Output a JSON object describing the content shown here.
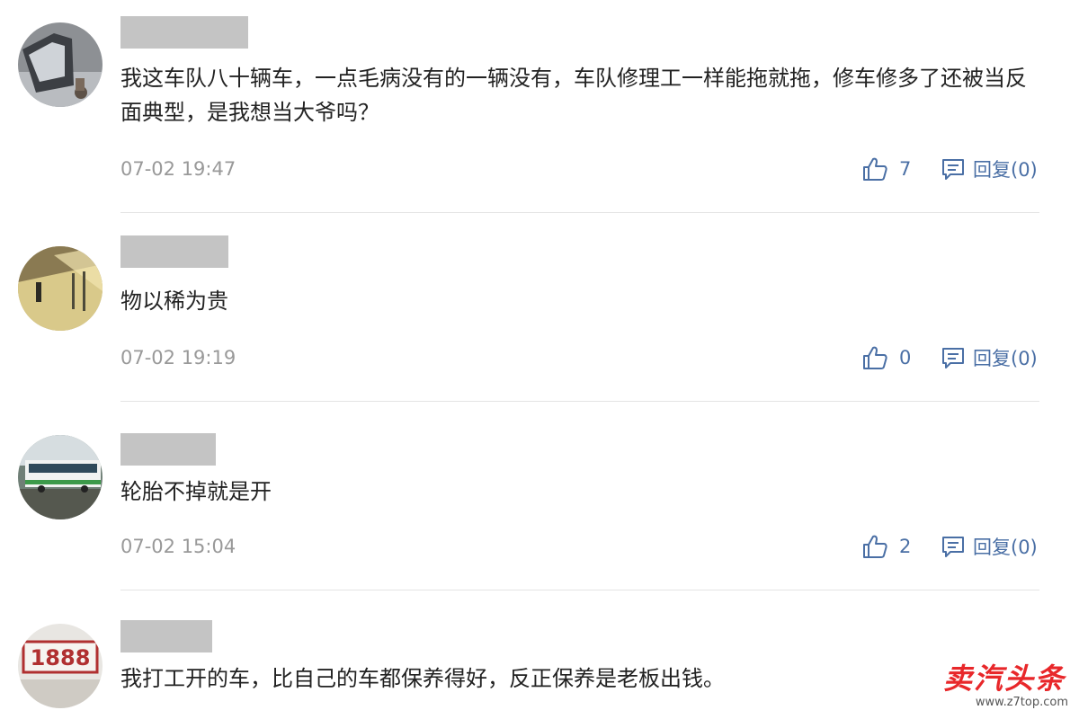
{
  "comments": [
    {
      "avatar": "car-photo-avatar",
      "text": "我这车队八十辆车，一点毛病没有的一辆没有，车队修理工一样能拖就拖，修车修多了还被当反面典型，是我想当大爷吗？",
      "time": "07-02 19:47",
      "likes": "7",
      "reply": "回复(0)"
    },
    {
      "avatar": "sunset-photo-avatar",
      "text": "物以稀为贵",
      "time": "07-02 19:19",
      "likes": "0",
      "reply": "回复(0)"
    },
    {
      "avatar": "bus-photo-avatar",
      "text": "轮胎不掉就是开",
      "time": "07-02 15:04",
      "likes": "2",
      "reply": "回复(0)"
    },
    {
      "avatar": "number-plate-avatar",
      "avatar_text": "1888",
      "text": "我打工开的车，比自己的车都保养得好，反正保养是老板出钱。"
    }
  ],
  "watermark": {
    "title": "卖汽头条",
    "url": "www.z7top.com"
  },
  "colors": {
    "action": "#4a6fa5",
    "meta": "#999999",
    "text": "#222222",
    "watermark": "#e8272a"
  },
  "icons": {
    "like": "thumbs-up-icon",
    "reply": "comment-icon"
  }
}
